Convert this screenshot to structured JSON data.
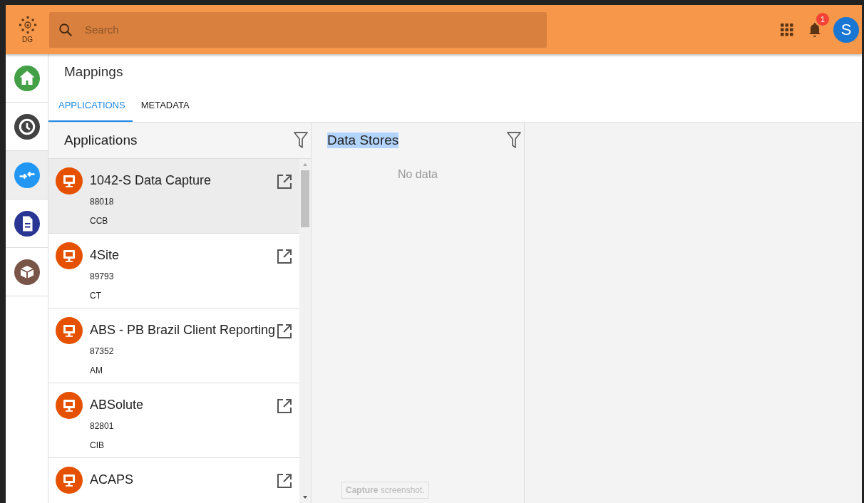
{
  "header": {
    "logo_text": "DG",
    "search": {
      "placeholder": "Search"
    },
    "notifications": {
      "count": "1"
    },
    "avatar": {
      "initial": "S"
    }
  },
  "sidebar": {
    "items": [
      {
        "kind": "home",
        "color": "#43a047",
        "selected": false
      },
      {
        "kind": "history",
        "color": "#424242",
        "selected": false
      },
      {
        "kind": "mappings",
        "color": "#2196f3",
        "selected": true
      },
      {
        "kind": "document",
        "color": "#283593",
        "selected": false
      },
      {
        "kind": "package",
        "color": "#795548",
        "selected": false
      }
    ]
  },
  "page": {
    "title": "Mappings",
    "tabs": [
      {
        "label": "APPLICATIONS",
        "selected": true
      },
      {
        "label": "METADATA",
        "selected": false
      }
    ]
  },
  "applications": {
    "title": "Applications",
    "items": [
      {
        "name": "1042-S Data Capture",
        "id": "88018",
        "code": "CCB",
        "selected": true
      },
      {
        "name": "4Site",
        "id": "89793",
        "code": "CT",
        "selected": false
      },
      {
        "name": "ABS - PB Brazil Client Reporting",
        "id": "87352",
        "code": "AM",
        "selected": false
      },
      {
        "name": "ABSolute",
        "id": "82801",
        "code": "CIB",
        "selected": false
      },
      {
        "name": "ACAPS",
        "selected": false
      }
    ]
  },
  "data_stores": {
    "title": "Data Stores",
    "title_highlighted": true,
    "empty_text": "No data"
  },
  "capture_button": {
    "label": "**Capture** screenshot."
  }
}
